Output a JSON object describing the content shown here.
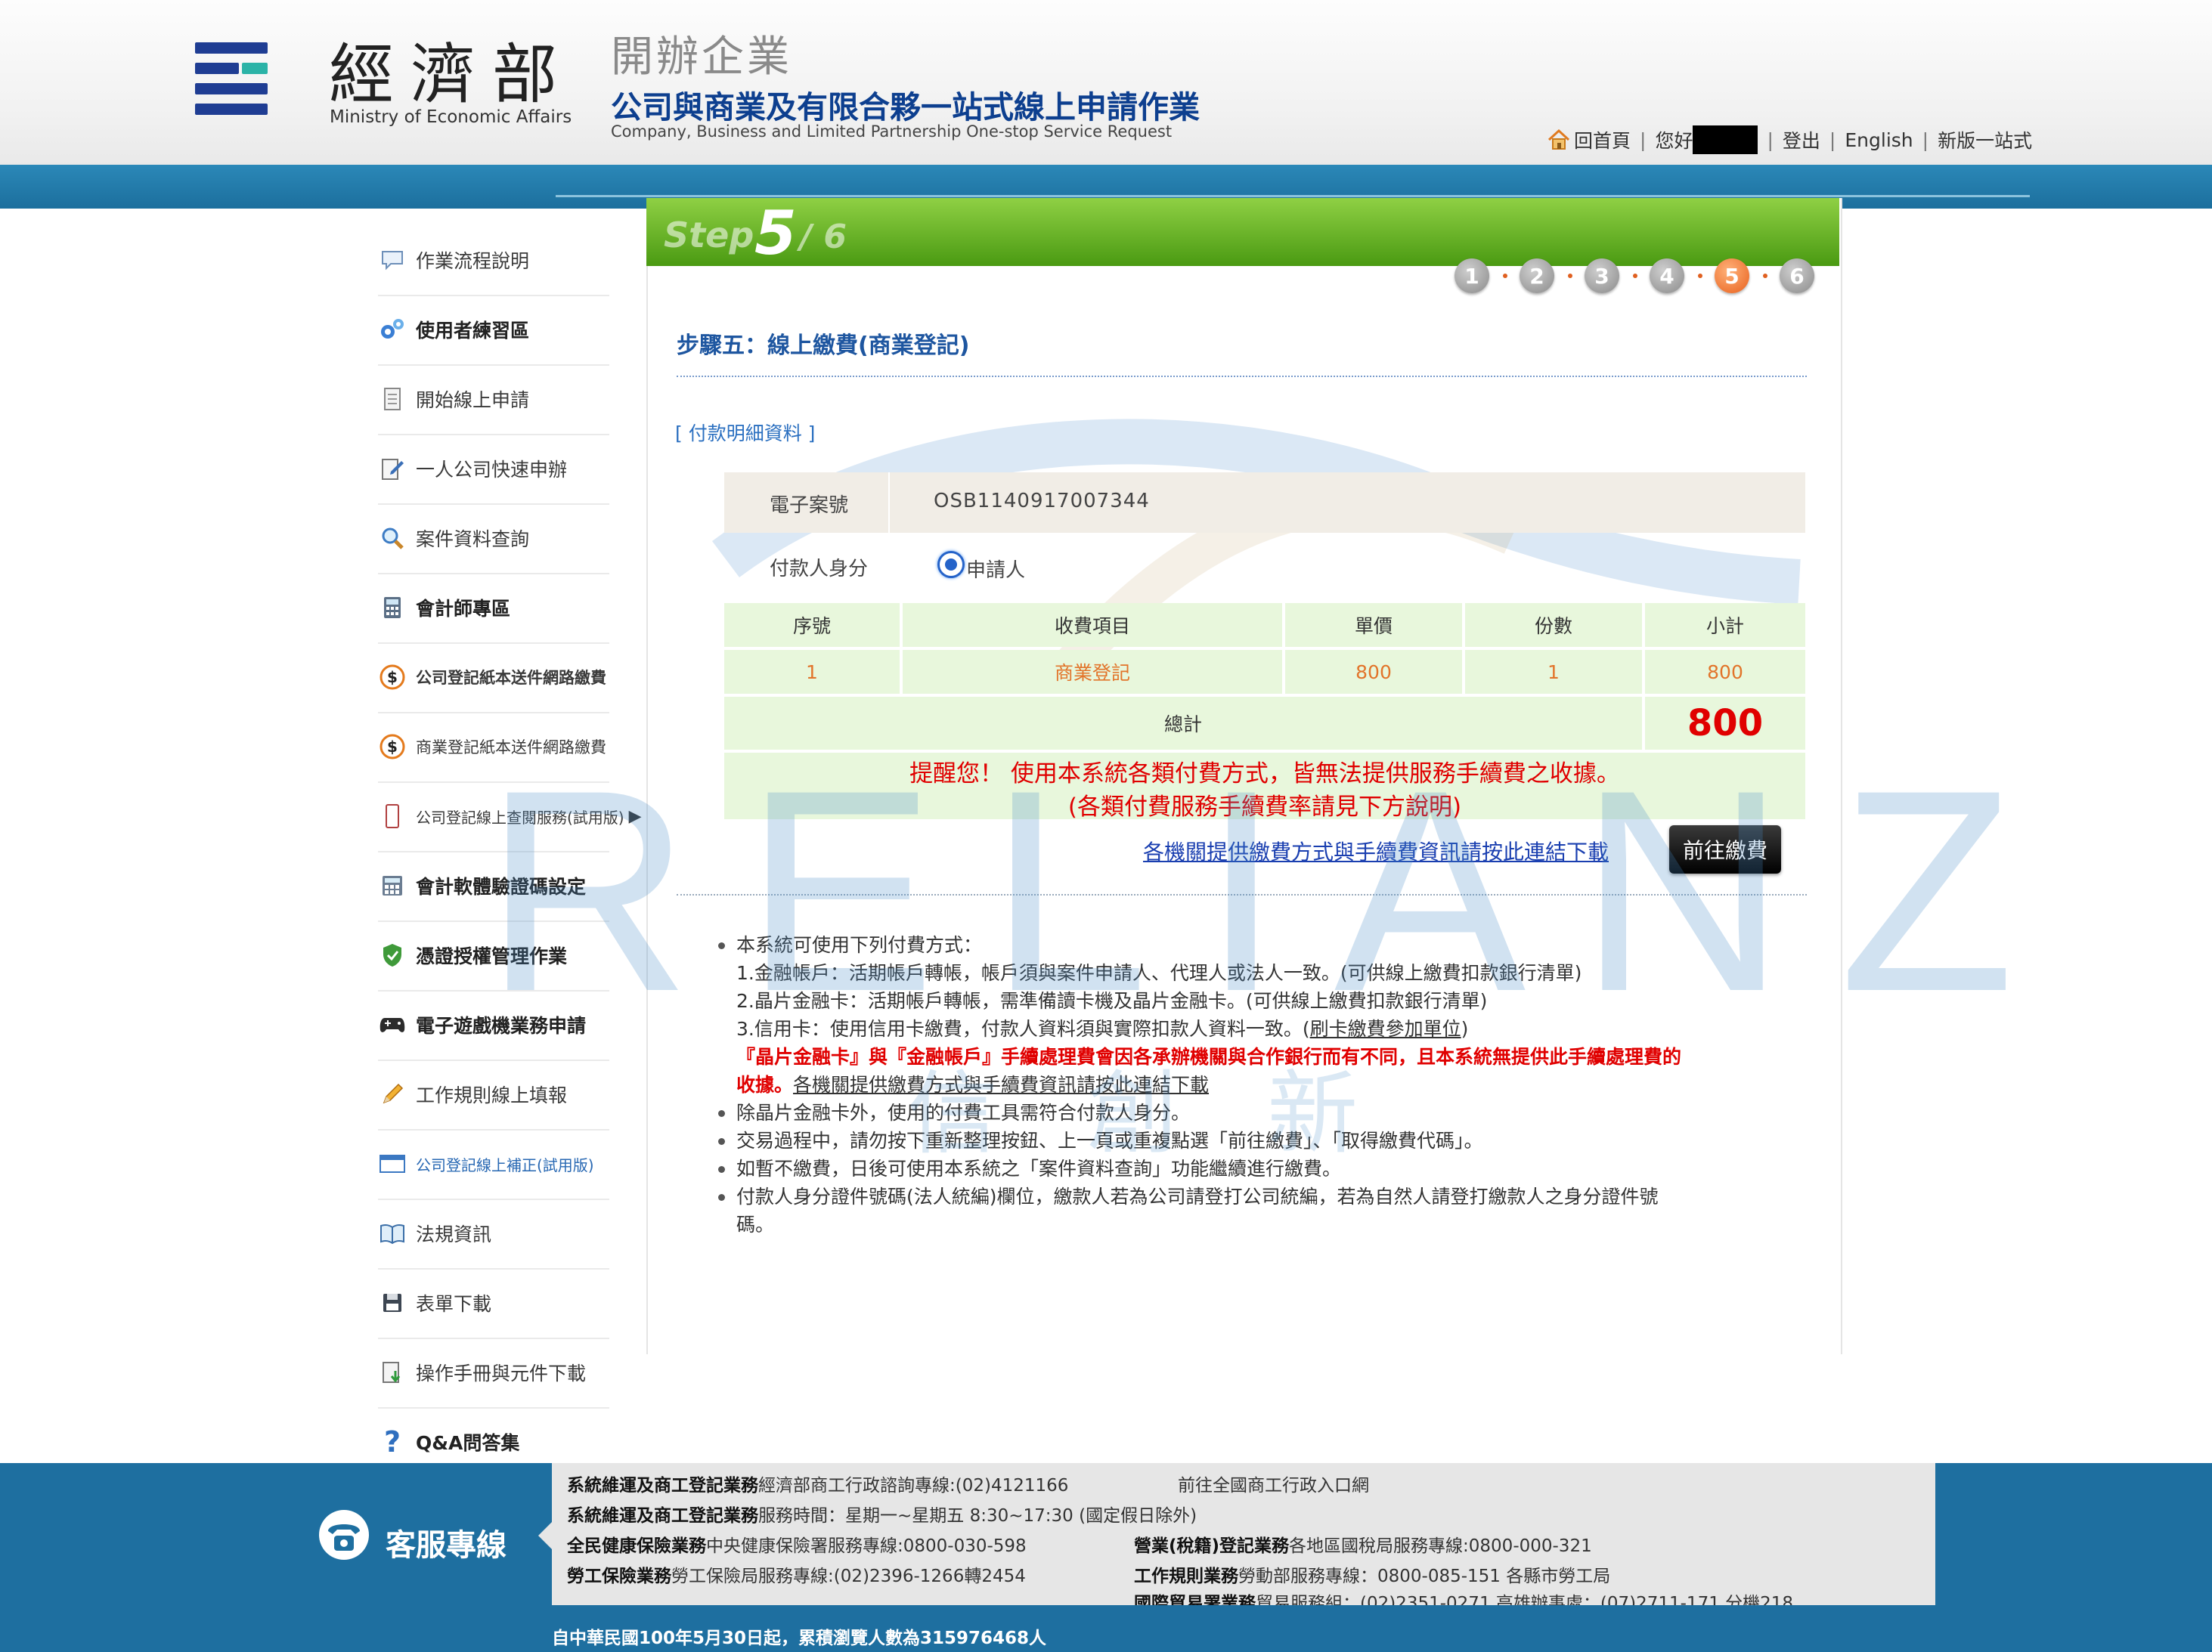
{
  "header": {
    "ministry_zh": "經濟部",
    "ministry_en": "Ministry of Economic Affairs",
    "title_zh_top": "開辦企業",
    "title_zh": "公司與商業及有限合夥一站式線上申請作業",
    "title_en": "Company, Business and Limited Partnership One-stop Service Request",
    "nav": {
      "home": "回首頁",
      "greeting": "您好",
      "logout": "登出",
      "english": "English",
      "new_version": "新版一站式"
    },
    "colors": {
      "logo_blue": "#1f3d93",
      "logo_teal": "#2bb3a7",
      "title_blue": "#0d3f8f"
    }
  },
  "sidebar": {
    "items": [
      {
        "label": "作業流程說明",
        "icon": "speech-bubble-icon"
      },
      {
        "label": "使用者練習區",
        "icon": "gears-icon"
      },
      {
        "label": "開始線上申請",
        "icon": "document-icon"
      },
      {
        "label": "一人公司快速申辦",
        "icon": "edit-note-icon"
      },
      {
        "label": "案件資料查詢",
        "icon": "magnifier-icon"
      },
      {
        "label": "會計師專區",
        "icon": "calculator-icon"
      },
      {
        "label": "公司登記紙本送件網路繳費",
        "icon": "dollar-icon"
      },
      {
        "label": "商業登記紙本送件網路繳費",
        "icon": "dollar-icon"
      },
      {
        "label": "公司登記線上查閱服務(試用版)",
        "icon": "page-icon"
      },
      {
        "label": "會計軟體驗證碼設定",
        "icon": "calculator-icon"
      },
      {
        "label": "憑證授權管理作業",
        "icon": "shield-check-icon"
      },
      {
        "label": "電子遊戲機業務申請",
        "icon": "gamepad-icon"
      },
      {
        "label": "工作規則線上填報",
        "icon": "pencil-icon"
      },
      {
        "label": "公司登記線上補正(試用版)",
        "icon": "window-icon"
      },
      {
        "label": "法規資訊",
        "icon": "book-icon"
      },
      {
        "label": "表單下載",
        "icon": "floppy-icon"
      },
      {
        "label": "操作手冊與元件下載",
        "icon": "download-icon"
      },
      {
        "label": "Q&A問答集",
        "icon": "question-icon"
      }
    ]
  },
  "step": {
    "word": "Step",
    "current": "5",
    "total": "/ 6",
    "circles": [
      "1",
      "2",
      "3",
      "4",
      "5",
      "6"
    ],
    "active_index": 4
  },
  "main": {
    "page_title": "步驟五：線上繳費(商業登記)",
    "section_label": "[ 付款明細資料 ]",
    "case_label": "電子案號",
    "case_value": "OSB1140917007344",
    "payer_label": "付款人身分",
    "payer_option": "申請人",
    "table": {
      "headers": [
        "序號",
        "收費項目",
        "單價",
        "份數",
        "小計"
      ],
      "rows": [
        [
          "1",
          "商業登記",
          "800",
          "1",
          "800"
        ]
      ],
      "total_label": "總計",
      "total_value": "800"
    },
    "notice_line1": "提醒您！ 使用本系統各類付費方式，皆無法提供服務手續費之收據。",
    "notice_line2": "(各類付費服務手續費率請見下方說明)",
    "fee_link": "各機關提供繳費方式與手續費資訊請按此連結下載",
    "pay_button": "前往繳費",
    "notes": {
      "n1": "本系統可使用下列付費方式：",
      "n1a": "1.金融帳戶：活期帳戶轉帳，帳戶須與案件申請人、代理人或法人一致。(可供線上繳費扣款銀行清單)",
      "n1b": "2.晶片金融卡：活期帳戶轉帳，需準備讀卡機及晶片金融卡。(可供線上繳費扣款銀行清單)",
      "n1c_pre": "3.信用卡：使用信用卡繳費，付款人資料須與實際扣款人資料一致。(",
      "n1c_link": "刷卡繳費參加單位",
      "n1c_post": ")",
      "red1": "『晶片金融卡』與『金融帳戶』手續處理費會因各承辦機關與合作銀行而有不同，且本系統無提供此手續處理費的",
      "red2": "收據。",
      "red_link": "各機關提供繳費方式與手續費資訊請按此連結下載",
      "n2": "除晶片金融卡外，使用的付費工具需符合付款人身分。",
      "n3": "交易過程中，請勿按下重新整理按鈕、上一頁或重複點選「前往繳費」、「取得繳費代碼」。",
      "n4": "如暫不繳費，日後可使用本系統之「案件資料查詢」功能繼續進行繳費。",
      "n5a": "付款人身分證件號碼(法人統編)欄位，繳款人若為公司請登打公司統編，若為自然人請登打繳款人之身分證件號",
      "n5b": "碼。"
    },
    "watermark": "RELIANZ",
    "watermark_cn": "信 創 新"
  },
  "footer": {
    "cs_label": "客服專線",
    "l1b": "系統維運及商工登記業務",
    "l1": "經濟部商工行政諮詢專線:(02)4121166",
    "l1r": "前往全國商工行政入口網",
    "l2b": "系統維運及商工登記業務",
    "l2": "服務時間：星期一~星期五 8:30~17:30 (國定假日除外)",
    "l3b": "全民健康保險業務",
    "l3": "中央健康保險署服務專線:0800-030-598",
    "l3rb": "營業(稅籍)登記業務",
    "l3r": "各地區國稅局服務專線:0800-000-321",
    "l4b": "勞工保險業務",
    "l4": "勞工保險局服務專線:(02)2396-1266轉2454",
    "l4rb": "工作規則業務",
    "l4r": "勞動部服務專線：0800-085-151 各縣市勞工局",
    "l5rb": "國際貿易署業務",
    "l5r": "貿易服務組：(02)2351-0271 高雄辦事處：(07)2711-171 分機218",
    "counter": "自中華民國100年5月30日起，累積瀏覽人數為315976468人"
  }
}
